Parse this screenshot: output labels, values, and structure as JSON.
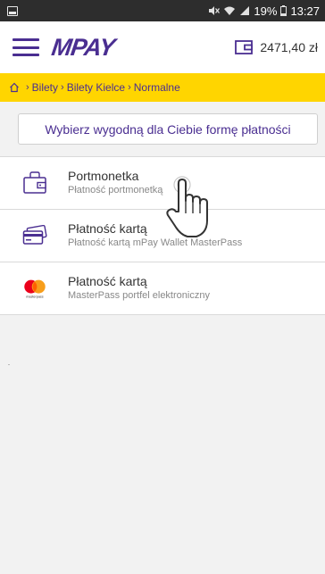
{
  "status_bar": {
    "battery": "19%",
    "time": "13:27"
  },
  "header": {
    "logo": "MPAY",
    "wallet_amount": "2471,40 zł"
  },
  "breadcrumb": {
    "items": [
      "Bilety",
      "Bilety Kielce",
      "Normalne"
    ]
  },
  "notice": {
    "text": "Wybierz wygodną dla Ciebie formę płatności"
  },
  "methods": [
    {
      "title": "Portmonetka",
      "subtitle": "Płatność portmonetką",
      "icon": "wallet-icon"
    },
    {
      "title": "Płatność kartą",
      "subtitle": "Płatność kartą mPay Wallet MasterPass",
      "icon": "credit-card-icon"
    },
    {
      "title": "Płatność kartą",
      "subtitle": "MasterPass portfel elektroniczny",
      "icon": "masterpass-icon",
      "icon_label": "masterpass"
    }
  ],
  "colors": {
    "brand": "#4a2e91",
    "accent": "#ffd500",
    "mastercard_red": "#eb001b",
    "mastercard_orange": "#f79e1b"
  }
}
